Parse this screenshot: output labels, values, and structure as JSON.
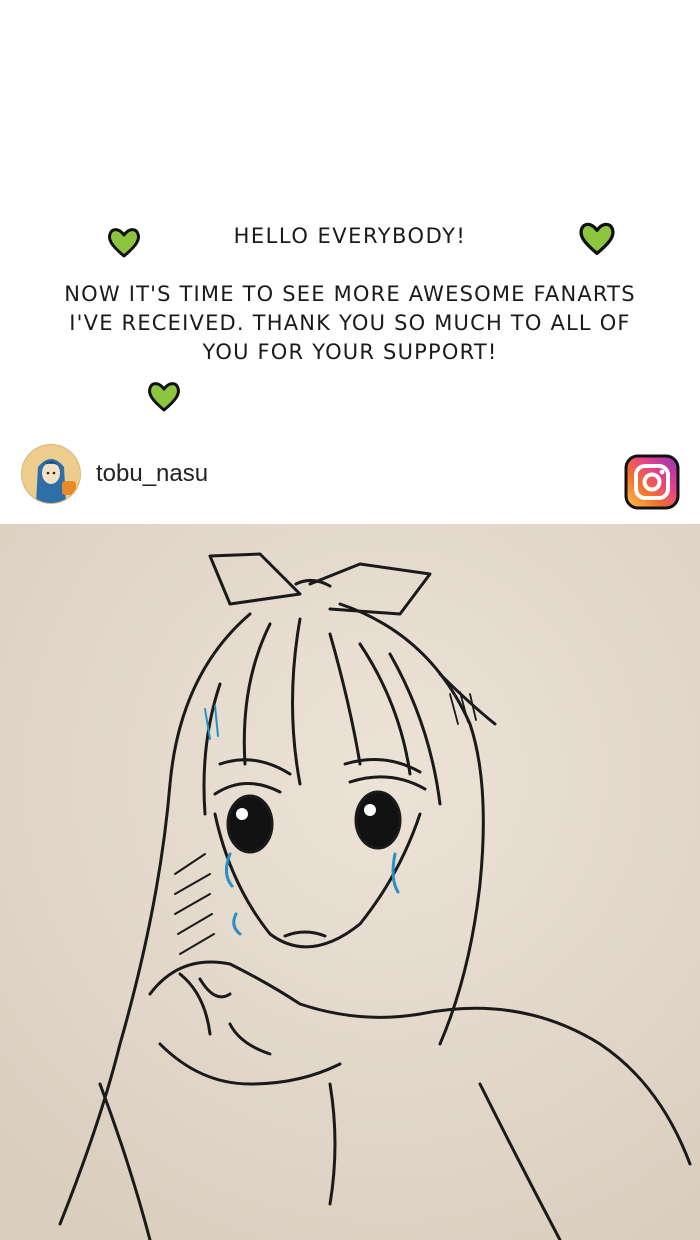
{
  "intro": {
    "greeting": "HELLO EVERYBODY!",
    "message": "NOW IT'S TIME TO SEE MORE AWESOME FANARTS I'VE RECEIVED. THANK YOU SO MUCH TO ALL OF YOU FOR YOUR SUPPORT!",
    "heart_color": "#8cc63f"
  },
  "post": {
    "username": "tobu_nasu",
    "avatar_icon": "avatar-portrait",
    "platform_icon": "instagram-icon"
  },
  "artwork": {
    "subject": "ink-drawing",
    "paper_color": "#e6dccf"
  }
}
